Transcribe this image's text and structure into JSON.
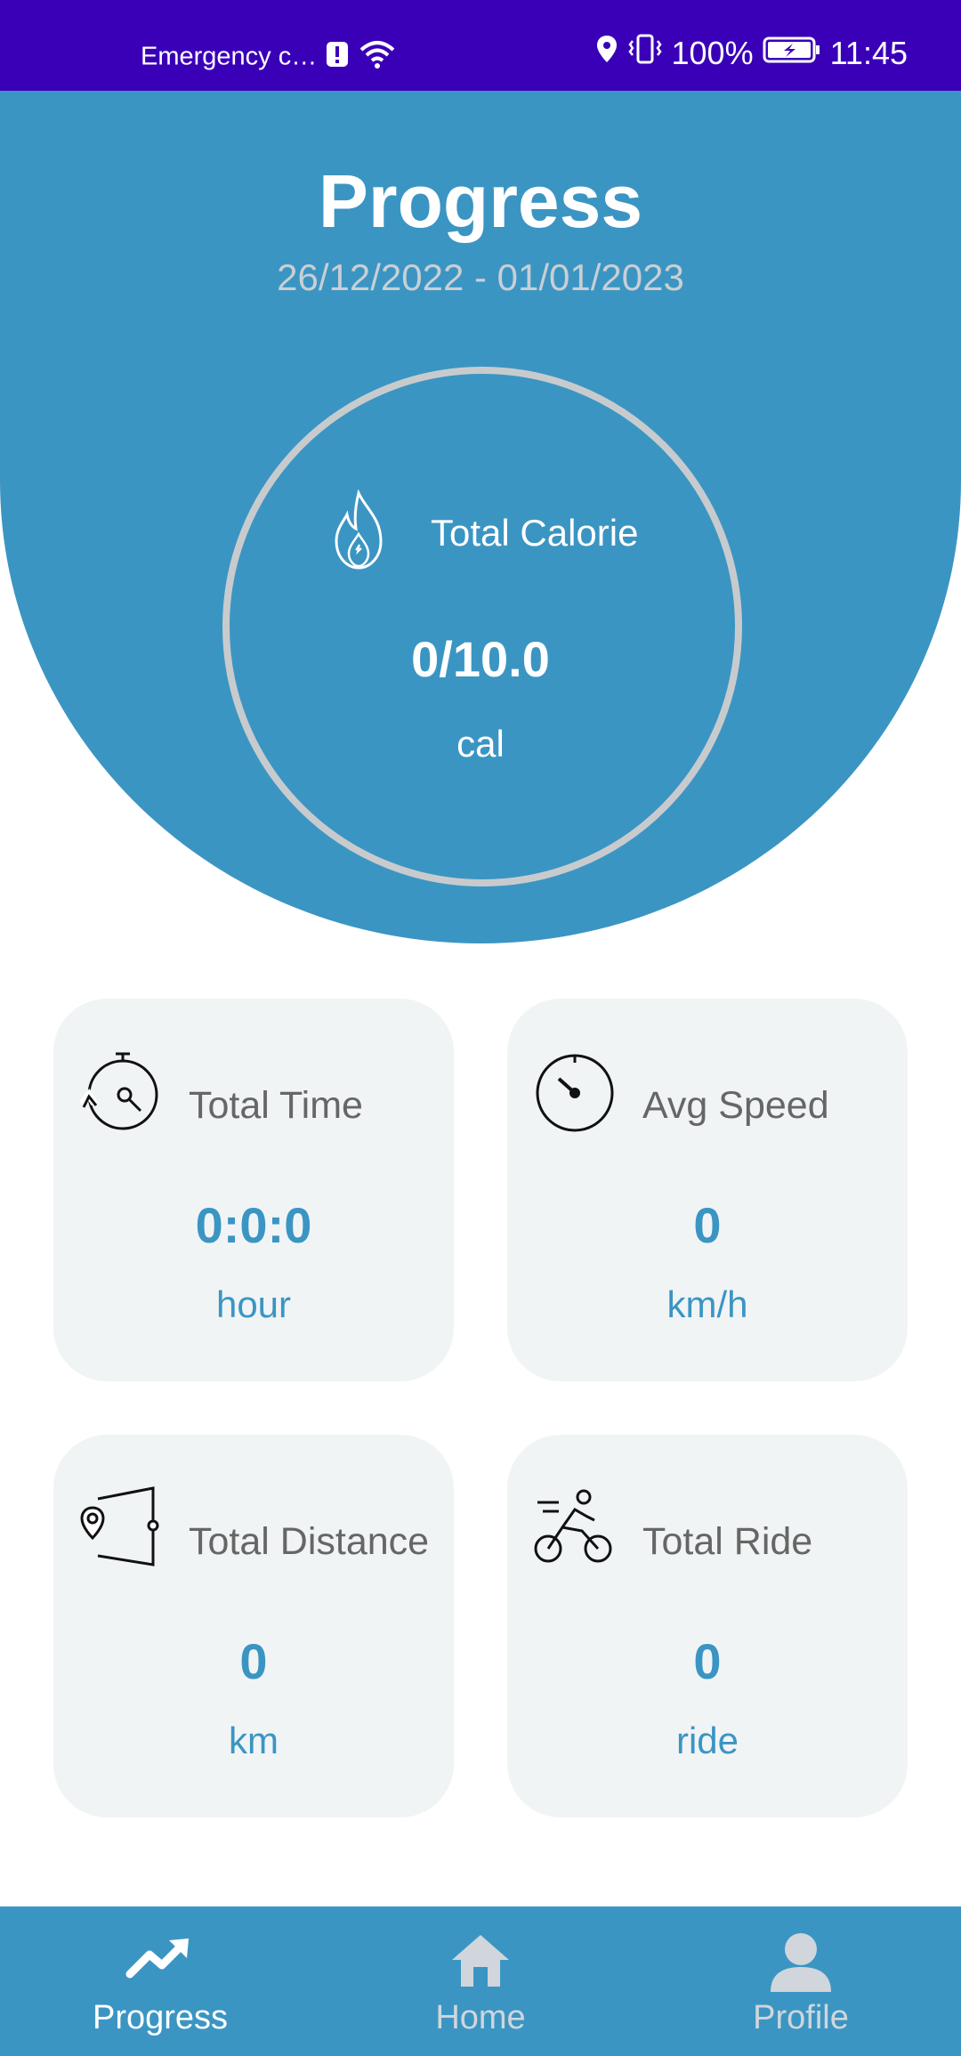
{
  "status_bar": {
    "carrier": "Emergency c…",
    "battery": "100%",
    "time": "11:45"
  },
  "header": {
    "title": "Progress",
    "date_range": "26/12/2022 - 01/01/2023"
  },
  "calorie": {
    "label": "Total Calorie",
    "value": "0/10.0",
    "unit": "cal",
    "icon": "flame-icon"
  },
  "cards": {
    "time": {
      "label": "Total Time",
      "value": "0:0:0",
      "unit": "hour",
      "icon": "stopwatch-icon"
    },
    "speed": {
      "label": "Avg Speed",
      "value": "0",
      "unit": "km/h",
      "icon": "speedometer-icon"
    },
    "distance": {
      "label": "Total Distance",
      "value": "0",
      "unit": "km",
      "icon": "map-pin-icon"
    },
    "ride": {
      "label": "Total Ride",
      "value": "0",
      "unit": "ride",
      "icon": "bicycle-icon"
    }
  },
  "nav": {
    "items": [
      {
        "label": "Progress",
        "icon": "trending-up-icon",
        "active": true
      },
      {
        "label": "Home",
        "icon": "home-icon",
        "active": false
      },
      {
        "label": "Profile",
        "icon": "person-icon",
        "active": false
      }
    ]
  },
  "colors": {
    "primary": "#3b95c3",
    "status_bar": "#3a00b8",
    "card_bg": "#f1f4f5",
    "ring": "#c8cbce"
  }
}
